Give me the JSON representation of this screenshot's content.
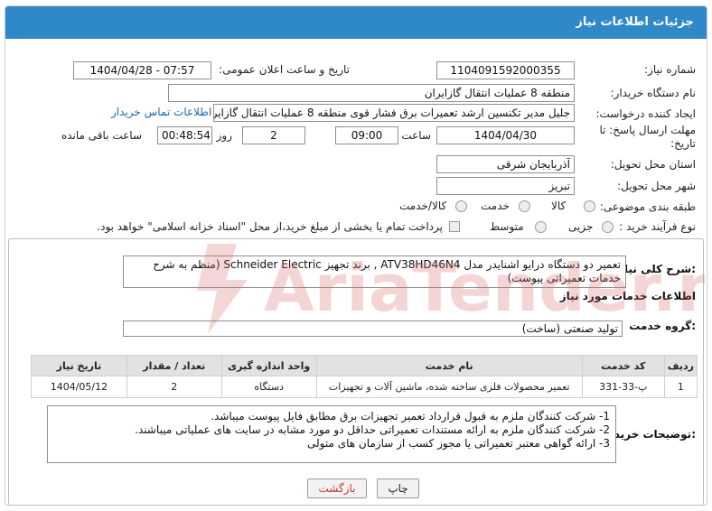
{
  "header": {
    "title": "جزئیات اطلاعات نیاز"
  },
  "form": {
    "need_number": {
      "label": "شماره نیاز:",
      "value": "1104091592000355"
    },
    "announce_datetime": {
      "label": "تاریخ و ساعت اعلان عمومی:",
      "value": "1404/04/28 - 07:57"
    },
    "buyer_org": {
      "label": "نام دستگاه خریدار:",
      "value": "منطقه 8 عملیات انتقال گازایران"
    },
    "requester": {
      "label": "ایجاد کننده درخواست:",
      "value": "جلیل مدیر تکنسین ارشد تعمیرات برق فشار قوی منطقه 8 عملیات انتقال گازایران",
      "contact_link": "اطلاعات تماس خریدار"
    },
    "deadline": {
      "label_line1": "مهلت ارسال پاسخ: تا",
      "label_line2": "تاریخ:",
      "date": "1404/04/30",
      "time_label": "ساعت",
      "time": "09:00",
      "days": "2",
      "days_label": "روز و",
      "remaining": "00:48:54",
      "remaining_label": "ساعت باقی مانده"
    },
    "province": {
      "label": "استان محل تحویل:",
      "value": "آذربایجان شرقی"
    },
    "city": {
      "label": "شهر محل تحویل:",
      "value": "تبریز"
    },
    "category": {
      "label": "طبقه بندی موضوعی:",
      "options": [
        "کالا",
        "خدمت",
        "کالا/خدمت"
      ]
    },
    "process": {
      "label": "نوع فرآیند خرید :",
      "options": [
        "جزیی",
        "متوسط"
      ],
      "treasury_note": "پرداخت تمام یا بخشی از مبلغ خرید،از محل \"اسناد خزانه اسلامی\" خواهد بود."
    }
  },
  "general_desc": {
    "label": "شرح کلی نیاز:",
    "value": "تعمیر دو دستگاه درایو اشنایدر مدل ATV38HD46N4 , برند تجهیز Schneider Electric (منظم به شرح خدمات تعمیراتی پیوست)"
  },
  "services": {
    "section_title": "اطلاعات خدمات مورد نیاز",
    "group_label": "گروه خدمت:",
    "group_value": "تولید صنعتی (ساخت)",
    "columns": [
      "ردیف",
      "کد خدمت",
      "نام خدمت",
      "واحد اندازه گیری",
      "تعداد / مقدار",
      "تاریخ نیاز"
    ],
    "rows": [
      [
        "1",
        "پ-33-331",
        "تعمیر محصولات فلزی ساخته شده، ماشین آلات و تجهیزات",
        "دستگاه",
        "2",
        "1404/05/12"
      ]
    ]
  },
  "buyer_notes": {
    "label": "توضیحات خریدار:",
    "lines": [
      "1-    شرکت کنندگان ملزم به قبول قرارداد تعمیر تجهیزات برق مطابق فایل پیوست میباشد.",
      "2-    شرکت کنندگان ملزم به ارائه مستندات تعمیراتی حداقل دو مورد مشابه در سایت های عملیاتی میباشند.",
      "3-    ارائه گواهی معتبر تعمیراتی یا مجوز کسب از سازمان های متولی"
    ]
  },
  "buttons": {
    "print": "چاپ",
    "back": "بازگشت"
  },
  "watermark": {
    "text": "AriaTender.neT"
  },
  "colors": {
    "header": "#2f88c8",
    "link": "#1a66b3",
    "back_text": "#c0392b",
    "watermark": "#e8a0a0"
  }
}
